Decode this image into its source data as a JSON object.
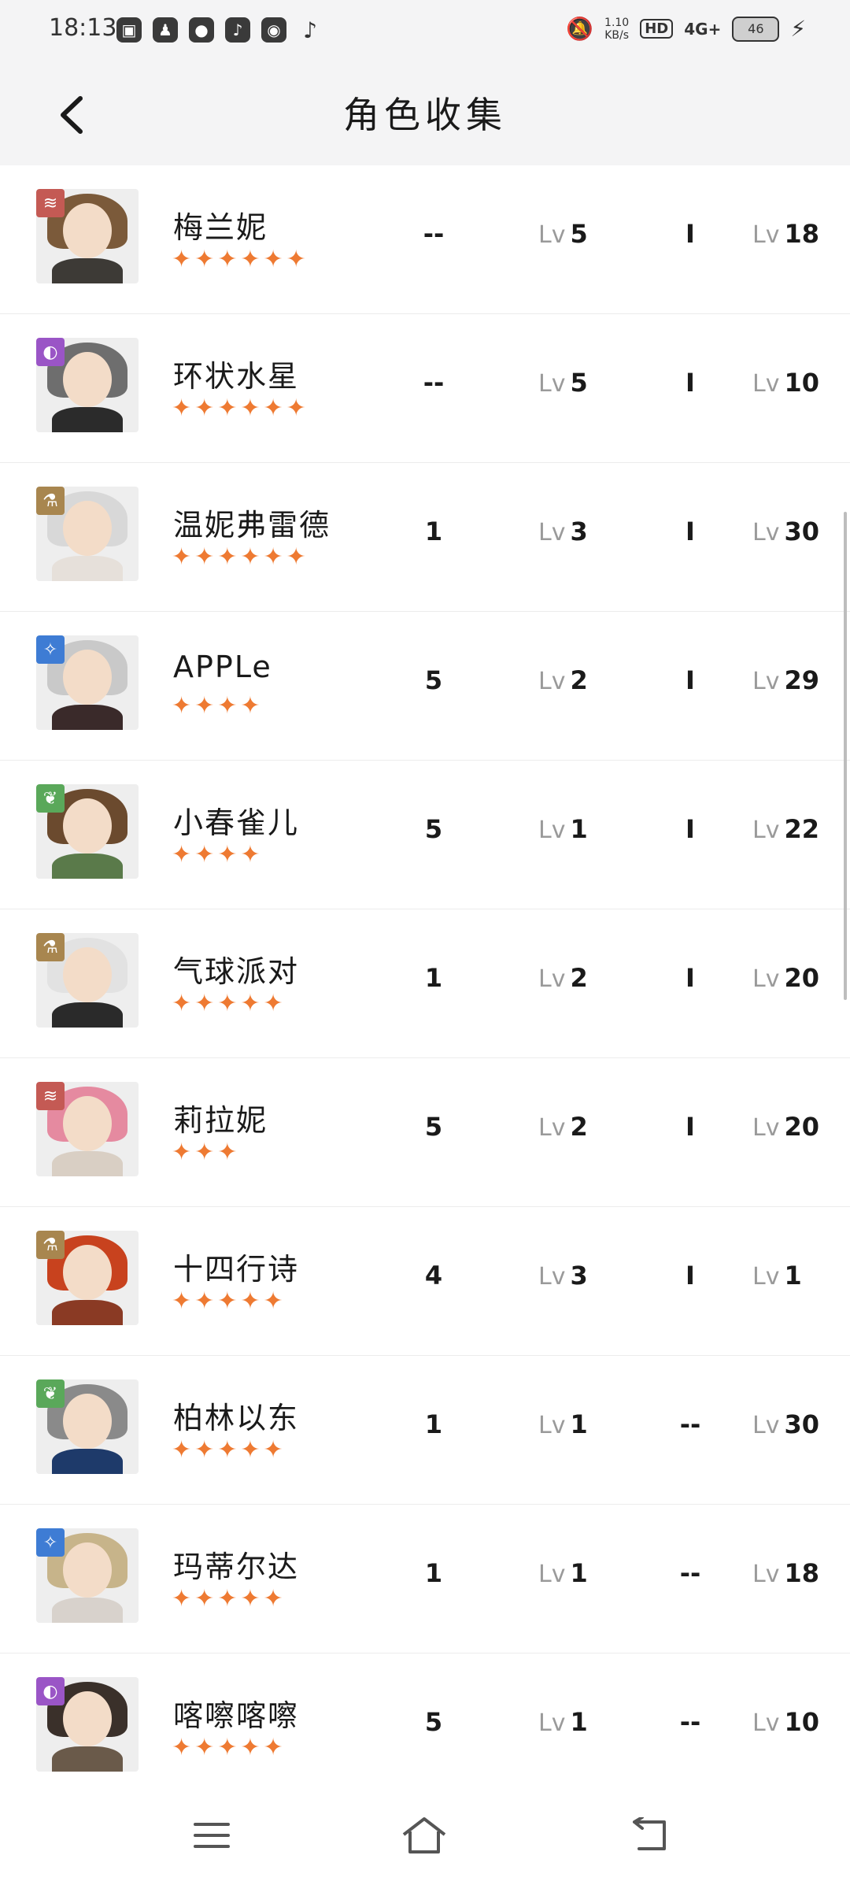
{
  "status_bar": {
    "time": "18:13",
    "app_icons": [
      "bilibili-icon",
      "qq-icon",
      "message-icon",
      "music-app-icon",
      "wechat-icon",
      "tiktok-icon"
    ],
    "net_speed": "1.10\nKB/s",
    "hd_label": "HD",
    "network": "4G+",
    "battery": "46"
  },
  "header": {
    "title": "角色收集",
    "back_icon": "chevron-left-icon"
  },
  "colors": {
    "star": "#ee7a32",
    "badge_red": "#c45a54",
    "badge_purple": "#9a55c6",
    "badge_gold": "#a8864f",
    "badge_blue": "#3e7cd4",
    "badge_green": "#5aa85a"
  },
  "characters": [
    {
      "name": "梅兰妮",
      "stars": "✦✦✦✦✦✦",
      "v1": "--",
      "lv_label": "Lv",
      "level": "5",
      "tier": "I",
      "lv_label2": "Lv",
      "level2": "18",
      "badge": "red"
    },
    {
      "name": "环状水星",
      "stars": "✦✦✦✦✦✦",
      "v1": "--",
      "lv_label": "Lv",
      "level": "5",
      "tier": "I",
      "lv_label2": "Lv",
      "level2": "10",
      "badge": "purple"
    },
    {
      "name": "温妮弗雷德",
      "stars": "✦✦✦✦✦✦",
      "v1": "1",
      "lv_label": "Lv",
      "level": "3",
      "tier": "I",
      "lv_label2": "Lv",
      "level2": "30",
      "badge": "gold"
    },
    {
      "name": "APPLe",
      "stars": "✦✦✦✦",
      "v1": "5",
      "lv_label": "Lv",
      "level": "2",
      "tier": "I",
      "lv_label2": "Lv",
      "level2": "29",
      "badge": "blue"
    },
    {
      "name": "小春雀儿",
      "stars": "✦✦✦✦",
      "v1": "5",
      "lv_label": "Lv",
      "level": "1",
      "tier": "I",
      "lv_label2": "Lv",
      "level2": "22",
      "badge": "green"
    },
    {
      "name": "气球派对",
      "stars": "✦✦✦✦✦",
      "v1": "1",
      "lv_label": "Lv",
      "level": "2",
      "tier": "I",
      "lv_label2": "Lv",
      "level2": "20",
      "badge": "gold"
    },
    {
      "name": "莉拉妮",
      "stars": "✦✦✦",
      "v1": "5",
      "lv_label": "Lv",
      "level": "2",
      "tier": "I",
      "lv_label2": "Lv",
      "level2": "20",
      "badge": "red"
    },
    {
      "name": "十四行诗",
      "stars": "✦✦✦✦✦",
      "v1": "4",
      "lv_label": "Lv",
      "level": "3",
      "tier": "I",
      "lv_label2": "Lv",
      "level2": "1",
      "badge": "gold"
    },
    {
      "name": "柏林以东",
      "stars": "✦✦✦✦✦",
      "v1": "1",
      "lv_label": "Lv",
      "level": "1",
      "tier": "--",
      "lv_label2": "Lv",
      "level2": "30",
      "badge": "green"
    },
    {
      "name": "玛蒂尔达",
      "stars": "✦✦✦✦✦",
      "v1": "1",
      "lv_label": "Lv",
      "level": "1",
      "tier": "--",
      "lv_label2": "Lv",
      "level2": "18",
      "badge": "blue"
    },
    {
      "name": "喀嚓喀嚓",
      "stars": "✦✦✦✦✦",
      "v1": "5",
      "lv_label": "Lv",
      "level": "1",
      "tier": "--",
      "lv_label2": "Lv",
      "level2": "10",
      "badge": "purple"
    }
  ],
  "nav": {
    "menu_icon": "menu-icon",
    "home_icon": "home-icon",
    "back_icon": "back-icon"
  }
}
